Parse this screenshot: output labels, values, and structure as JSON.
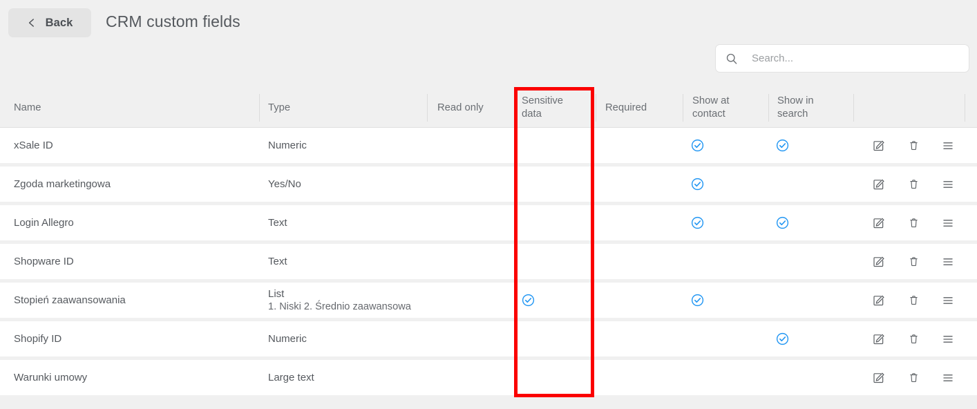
{
  "header": {
    "back_label": "Back",
    "back_icon": "chevron-left-icon",
    "title": "CRM custom fields"
  },
  "search": {
    "icon": "search-icon",
    "placeholder": "Search...",
    "value": ""
  },
  "table": {
    "columns": [
      {
        "key": "name",
        "label": "Name"
      },
      {
        "key": "type",
        "label": "Type"
      },
      {
        "key": "read_only",
        "label": "Read only"
      },
      {
        "key": "sensitive_data",
        "label": "Sensitive\ndata",
        "label_line1": "Sensitive",
        "label_line2": "data",
        "highlighted": true
      },
      {
        "key": "required",
        "label": "Required"
      },
      {
        "key": "show_at_contact",
        "label": "Show at\ncontact",
        "label_line1": "Show at",
        "label_line2": "contact"
      },
      {
        "key": "show_in_search",
        "label": "Show in\nsearch",
        "label_line1": "Show in",
        "label_line2": "search"
      },
      {
        "key": "actions",
        "label": ""
      }
    ],
    "rows": [
      {
        "name": "xSale ID",
        "type": "Numeric",
        "type_sub": "",
        "read_only": false,
        "sensitive_data": false,
        "required": false,
        "show_at_contact": true,
        "show_in_search": true
      },
      {
        "name": "Zgoda marketingowa",
        "type": "Yes/No",
        "type_sub": "",
        "read_only": false,
        "sensitive_data": false,
        "required": false,
        "show_at_contact": true,
        "show_in_search": false
      },
      {
        "name": "Login Allegro",
        "type": "Text",
        "type_sub": "",
        "read_only": false,
        "sensitive_data": false,
        "required": false,
        "show_at_contact": true,
        "show_in_search": true
      },
      {
        "name": "Shopware ID",
        "type": "Text",
        "type_sub": "",
        "read_only": false,
        "sensitive_data": false,
        "required": false,
        "show_at_contact": false,
        "show_in_search": false
      },
      {
        "name": "Stopień zaawansowania",
        "type": "List",
        "type_sub": "1. Niski 2. Średnio zaawansowa",
        "read_only": false,
        "sensitive_data": true,
        "required": false,
        "show_at_contact": true,
        "show_in_search": false
      },
      {
        "name": "Shopify ID",
        "type": "Numeric",
        "type_sub": "",
        "read_only": false,
        "sensitive_data": false,
        "required": false,
        "show_at_contact": false,
        "show_in_search": true
      },
      {
        "name": "Warunki umowy",
        "type": "Large text",
        "type_sub": "",
        "read_only": false,
        "sensitive_data": false,
        "required": false,
        "show_at_contact": false,
        "show_in_search": false
      }
    ],
    "row_actions": [
      {
        "name": "edit-row-button",
        "icon": "edit-pencil-icon"
      },
      {
        "name": "delete-row-button",
        "icon": "trash-icon"
      },
      {
        "name": "reorder-row-handle",
        "icon": "hamburger-menu-icon"
      }
    ]
  },
  "annotation": {
    "type": "highlight-box",
    "target_column": "Sensitive data",
    "color": "#fb0000"
  },
  "colors": {
    "page_background": "#f0f0f0",
    "row_background": "#ffffff",
    "accent_check": "#2196f3",
    "text_primary": "#55595e",
    "text_muted": "#6a6e73",
    "annotation": "#fb0000"
  }
}
